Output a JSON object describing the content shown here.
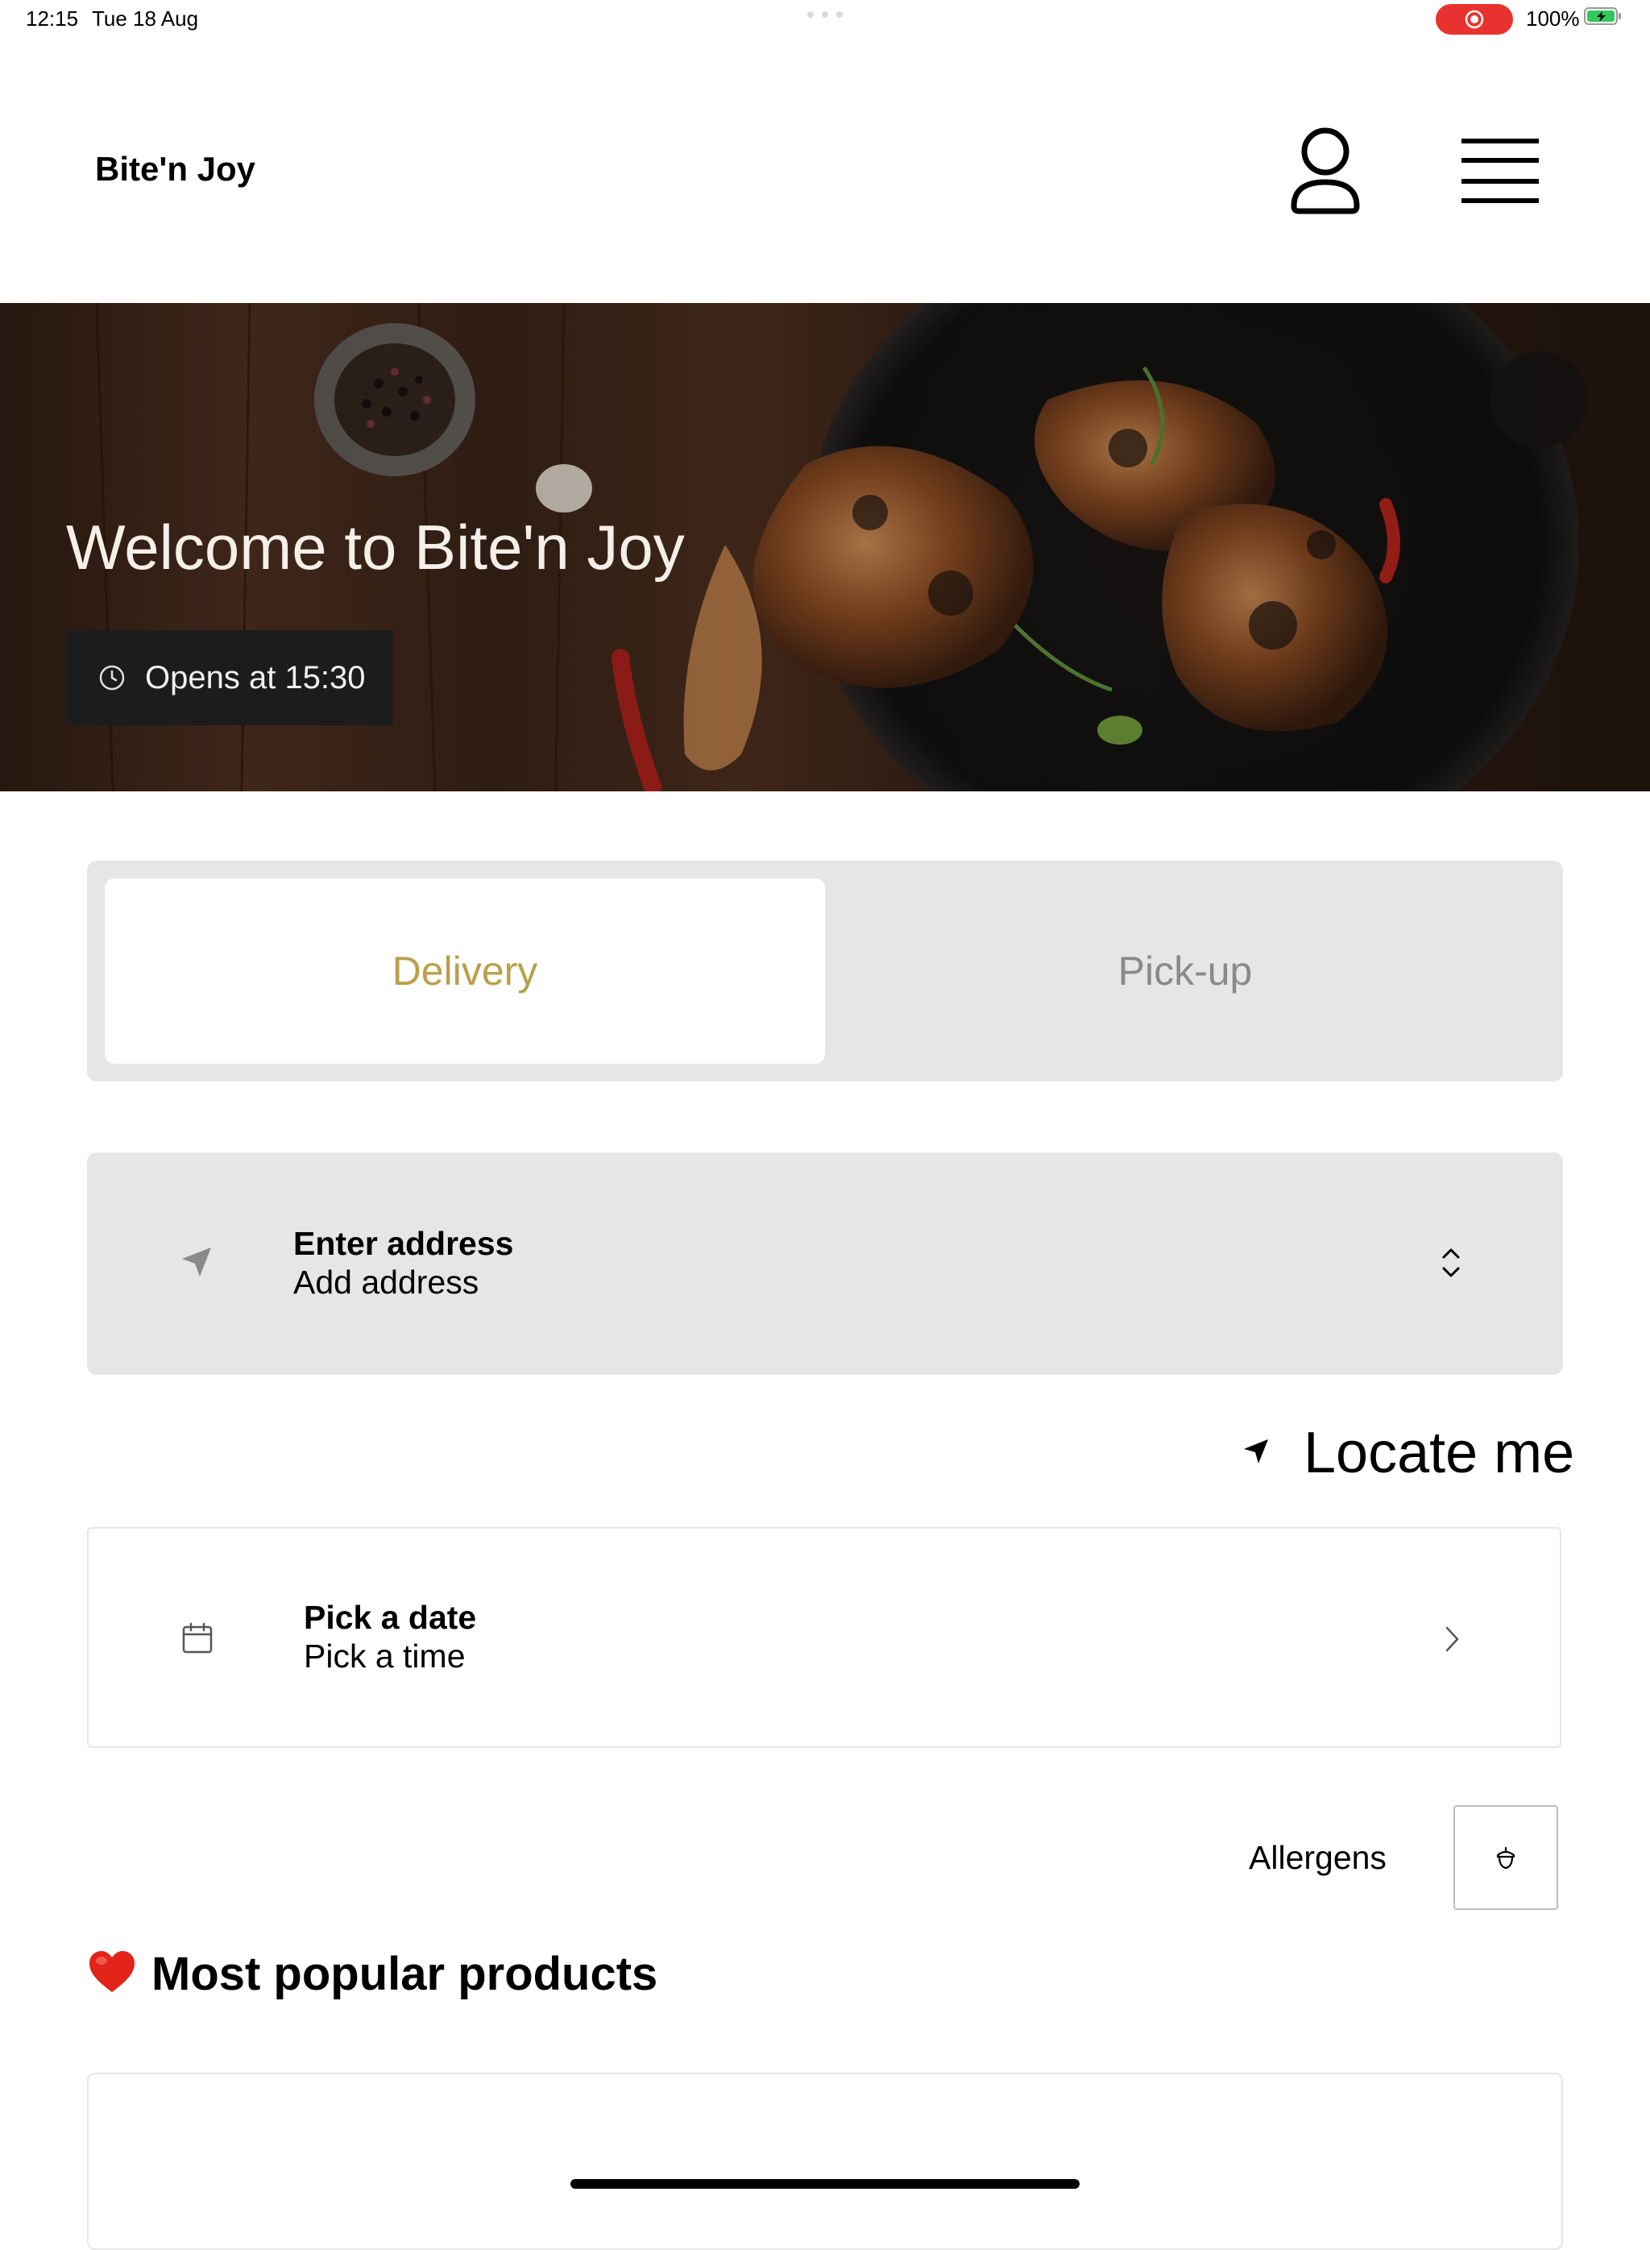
{
  "status_bar": {
    "time": "12:15",
    "date": "Tue 18 Aug",
    "battery": "100%"
  },
  "header": {
    "brand": "Bite'n Joy"
  },
  "hero": {
    "title": "Welcome to Bite'n Joy",
    "opens": "Opens at 15:30"
  },
  "order_mode": {
    "delivery_label": "Delivery",
    "pickup_label": "Pick-up",
    "selected": "Delivery"
  },
  "address": {
    "title": "Enter address",
    "subtitle": "Add address"
  },
  "locate_me": "Locate me",
  "schedule": {
    "title": "Pick a date",
    "subtitle": "Pick a time"
  },
  "allergens_label": "Allergens",
  "popular": {
    "title": "Most popular products"
  },
  "colors": {
    "accent": "#b9a04b",
    "panel": "#e6e6e6",
    "record": "#e8322f",
    "battery": "#34c759"
  }
}
